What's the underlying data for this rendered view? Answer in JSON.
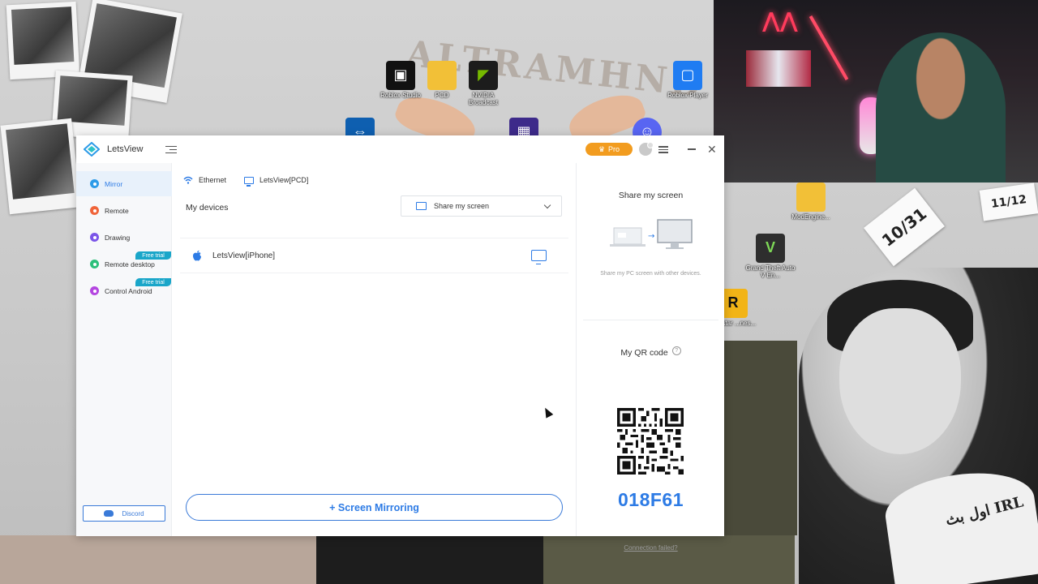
{
  "desktop": {
    "wallpaper_text": "ALTRAMHND",
    "icons": [
      {
        "label": "Roblox Studio",
        "icon": "roblox-studio-icon"
      },
      {
        "label": "PCD",
        "icon": "folder-icon"
      },
      {
        "label": "NVIDIA Broadcast",
        "icon": "nvidia-icon"
      },
      {
        "label": "Roblox Player",
        "icon": "roblox-player-icon"
      },
      {
        "label": "ModEngine...",
        "icon": "folder-icon"
      },
      {
        "label": "Grand Theft Auto V En...",
        "icon": "gta-icon"
      },
      {
        "label": "...ckstar ...nes...",
        "icon": "rockstar-icon"
      }
    ],
    "tickets": [
      "10/31",
      "11/12"
    ],
    "cake_text": "اول بث IRL"
  },
  "app": {
    "title": "LetsView",
    "pro_label": "Pro",
    "sidebar": {
      "items": [
        {
          "label": "Mirror",
          "color": "#2d9be8",
          "active": true
        },
        {
          "label": "Remote",
          "color": "#f0643a",
          "active": false
        },
        {
          "label": "Drawing",
          "color": "#7b55e8",
          "active": false
        },
        {
          "label": "Remote desktop",
          "color": "#2cbf7a",
          "active": false,
          "badge": "Free trial"
        },
        {
          "label": "Control Android",
          "color": "#b447e0",
          "active": false,
          "badge": "Free trial"
        }
      ],
      "discord_label": "Discord"
    },
    "main": {
      "tabs": [
        {
          "label": "Ethernet",
          "icon": "wifi-icon"
        },
        {
          "label": "LetsView[PCD]",
          "icon": "monitor-icon"
        }
      ],
      "devices_title": "My devices",
      "share_select": "Share my screen",
      "devices": [
        {
          "name": "LetsView[iPhone]",
          "icon": "apple-icon"
        }
      ],
      "mirror_button": "+ Screen Mirroring"
    },
    "right_panel": {
      "share_title": "Share my screen",
      "share_desc": "Share my PC screen with other devices.",
      "qr_title": "My QR code",
      "code": "018F61",
      "connection_failed": "Connection failed?"
    },
    "colors": {
      "accent": "#2d7be5",
      "pro": "#f29c1f",
      "trial_badge": "#1aa6c9"
    }
  }
}
